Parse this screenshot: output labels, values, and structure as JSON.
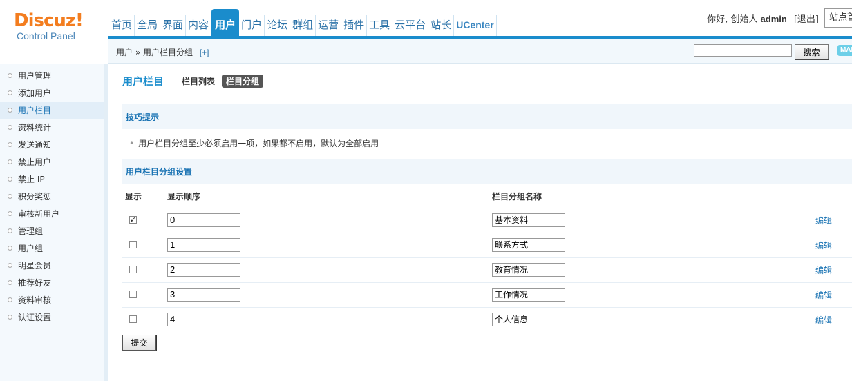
{
  "logo": {
    "main": "Discuz!",
    "sub": "Control Panel"
  },
  "topnav": [
    {
      "label": "首页",
      "active": false
    },
    {
      "label": "全局",
      "active": false
    },
    {
      "label": "界面",
      "active": false
    },
    {
      "label": "内容",
      "active": false
    },
    {
      "label": "用户",
      "active": true
    },
    {
      "label": "门户",
      "active": false
    },
    {
      "label": "论坛",
      "active": false
    },
    {
      "label": "群组",
      "active": false
    },
    {
      "label": "运营",
      "active": false
    },
    {
      "label": "插件",
      "active": false
    },
    {
      "label": "工具",
      "active": false
    },
    {
      "label": "云平台",
      "active": false
    },
    {
      "label": "站长",
      "active": false
    },
    {
      "label": "UCenter",
      "active": false
    }
  ],
  "header": {
    "greeting": "你好, 创始人",
    "username": "admin",
    "logout": "[退出]",
    "home_link": "站点首页"
  },
  "breadcrumb": {
    "path": "用户 » 用户栏目分组",
    "add": "[+]"
  },
  "search": {
    "value": "",
    "button": "搜索",
    "map_label": "MAP"
  },
  "sidebar": {
    "items": [
      {
        "label": "用户管理",
        "active": false
      },
      {
        "label": "添加用户",
        "active": false
      },
      {
        "label": "用户栏目",
        "active": true
      },
      {
        "label": "资料统计",
        "active": false
      },
      {
        "label": "发送通知",
        "active": false
      },
      {
        "label": "禁止用户",
        "active": false
      },
      {
        "label": "禁止 IP",
        "active": false
      },
      {
        "label": "积分奖惩",
        "active": false
      },
      {
        "label": "审核新用户",
        "active": false
      },
      {
        "label": "管理组",
        "active": false
      },
      {
        "label": "用户组",
        "active": false
      },
      {
        "label": "明星会员",
        "active": false
      },
      {
        "label": "推荐好友",
        "active": false
      },
      {
        "label": "资料审核",
        "active": false
      },
      {
        "label": "认证设置",
        "active": false
      }
    ]
  },
  "main": {
    "title": "用户栏目",
    "tabs": [
      {
        "label": "栏目列表",
        "active": false
      },
      {
        "label": "栏目分组",
        "active": true
      }
    ],
    "tips_title": "技巧提示",
    "tip": "用户栏目分组至少必须启用一项，如果都不启用，默认为全部启用",
    "settings_title": "用户栏目分组设置",
    "columns": {
      "show": "显示",
      "order": "显示顺序",
      "name": "栏目分组名称"
    },
    "rows": [
      {
        "checked": true,
        "order": "0",
        "name": "基本资料",
        "edit": "编辑"
      },
      {
        "checked": false,
        "order": "1",
        "name": "联系方式",
        "edit": "编辑"
      },
      {
        "checked": false,
        "order": "2",
        "name": "教育情况",
        "edit": "编辑"
      },
      {
        "checked": false,
        "order": "3",
        "name": "工作情况",
        "edit": "编辑"
      },
      {
        "checked": false,
        "order": "4",
        "name": "个人信息",
        "edit": "编辑"
      }
    ],
    "submit": "提交"
  },
  "colors": {
    "accent": "#1a8ccc",
    "logo_orange": "#f37d1f",
    "link": "#1a73b3"
  }
}
